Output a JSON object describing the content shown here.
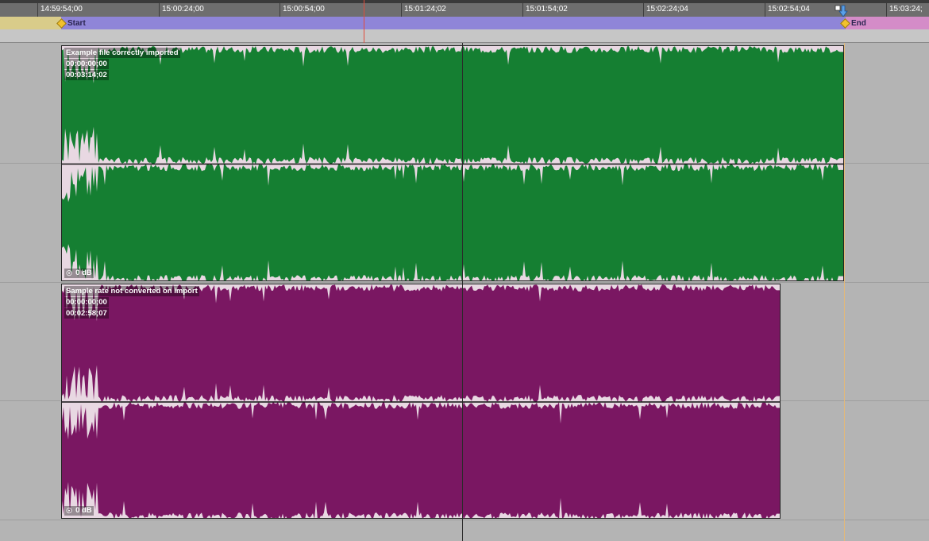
{
  "timeline": {
    "ruler_ticks": [
      "14:59:54;00",
      "15:00:24;00",
      "15:00:54;00",
      "15:01:24;02",
      "15:01:54;02",
      "15:02:24;04",
      "15:02:54;04",
      "15:03:24;"
    ]
  },
  "markers": {
    "start_label": "Start",
    "end_label": "End"
  },
  "clips": [
    {
      "name": "Example file correctly imported",
      "start": "00:00:00;00",
      "duration": "00:03:14;02",
      "gain": "0 dB",
      "color": "#157f32"
    },
    {
      "name": "Sample rate not converted on import",
      "start": "00:00:00;00",
      "duration": "00:02:58;07",
      "gain": "0 dB",
      "color": "#7a1762"
    }
  ],
  "colors": {
    "playhead": "#e24b3b",
    "cursor_line": "#2a2a2a",
    "end_marker_line": "#e3b878"
  }
}
